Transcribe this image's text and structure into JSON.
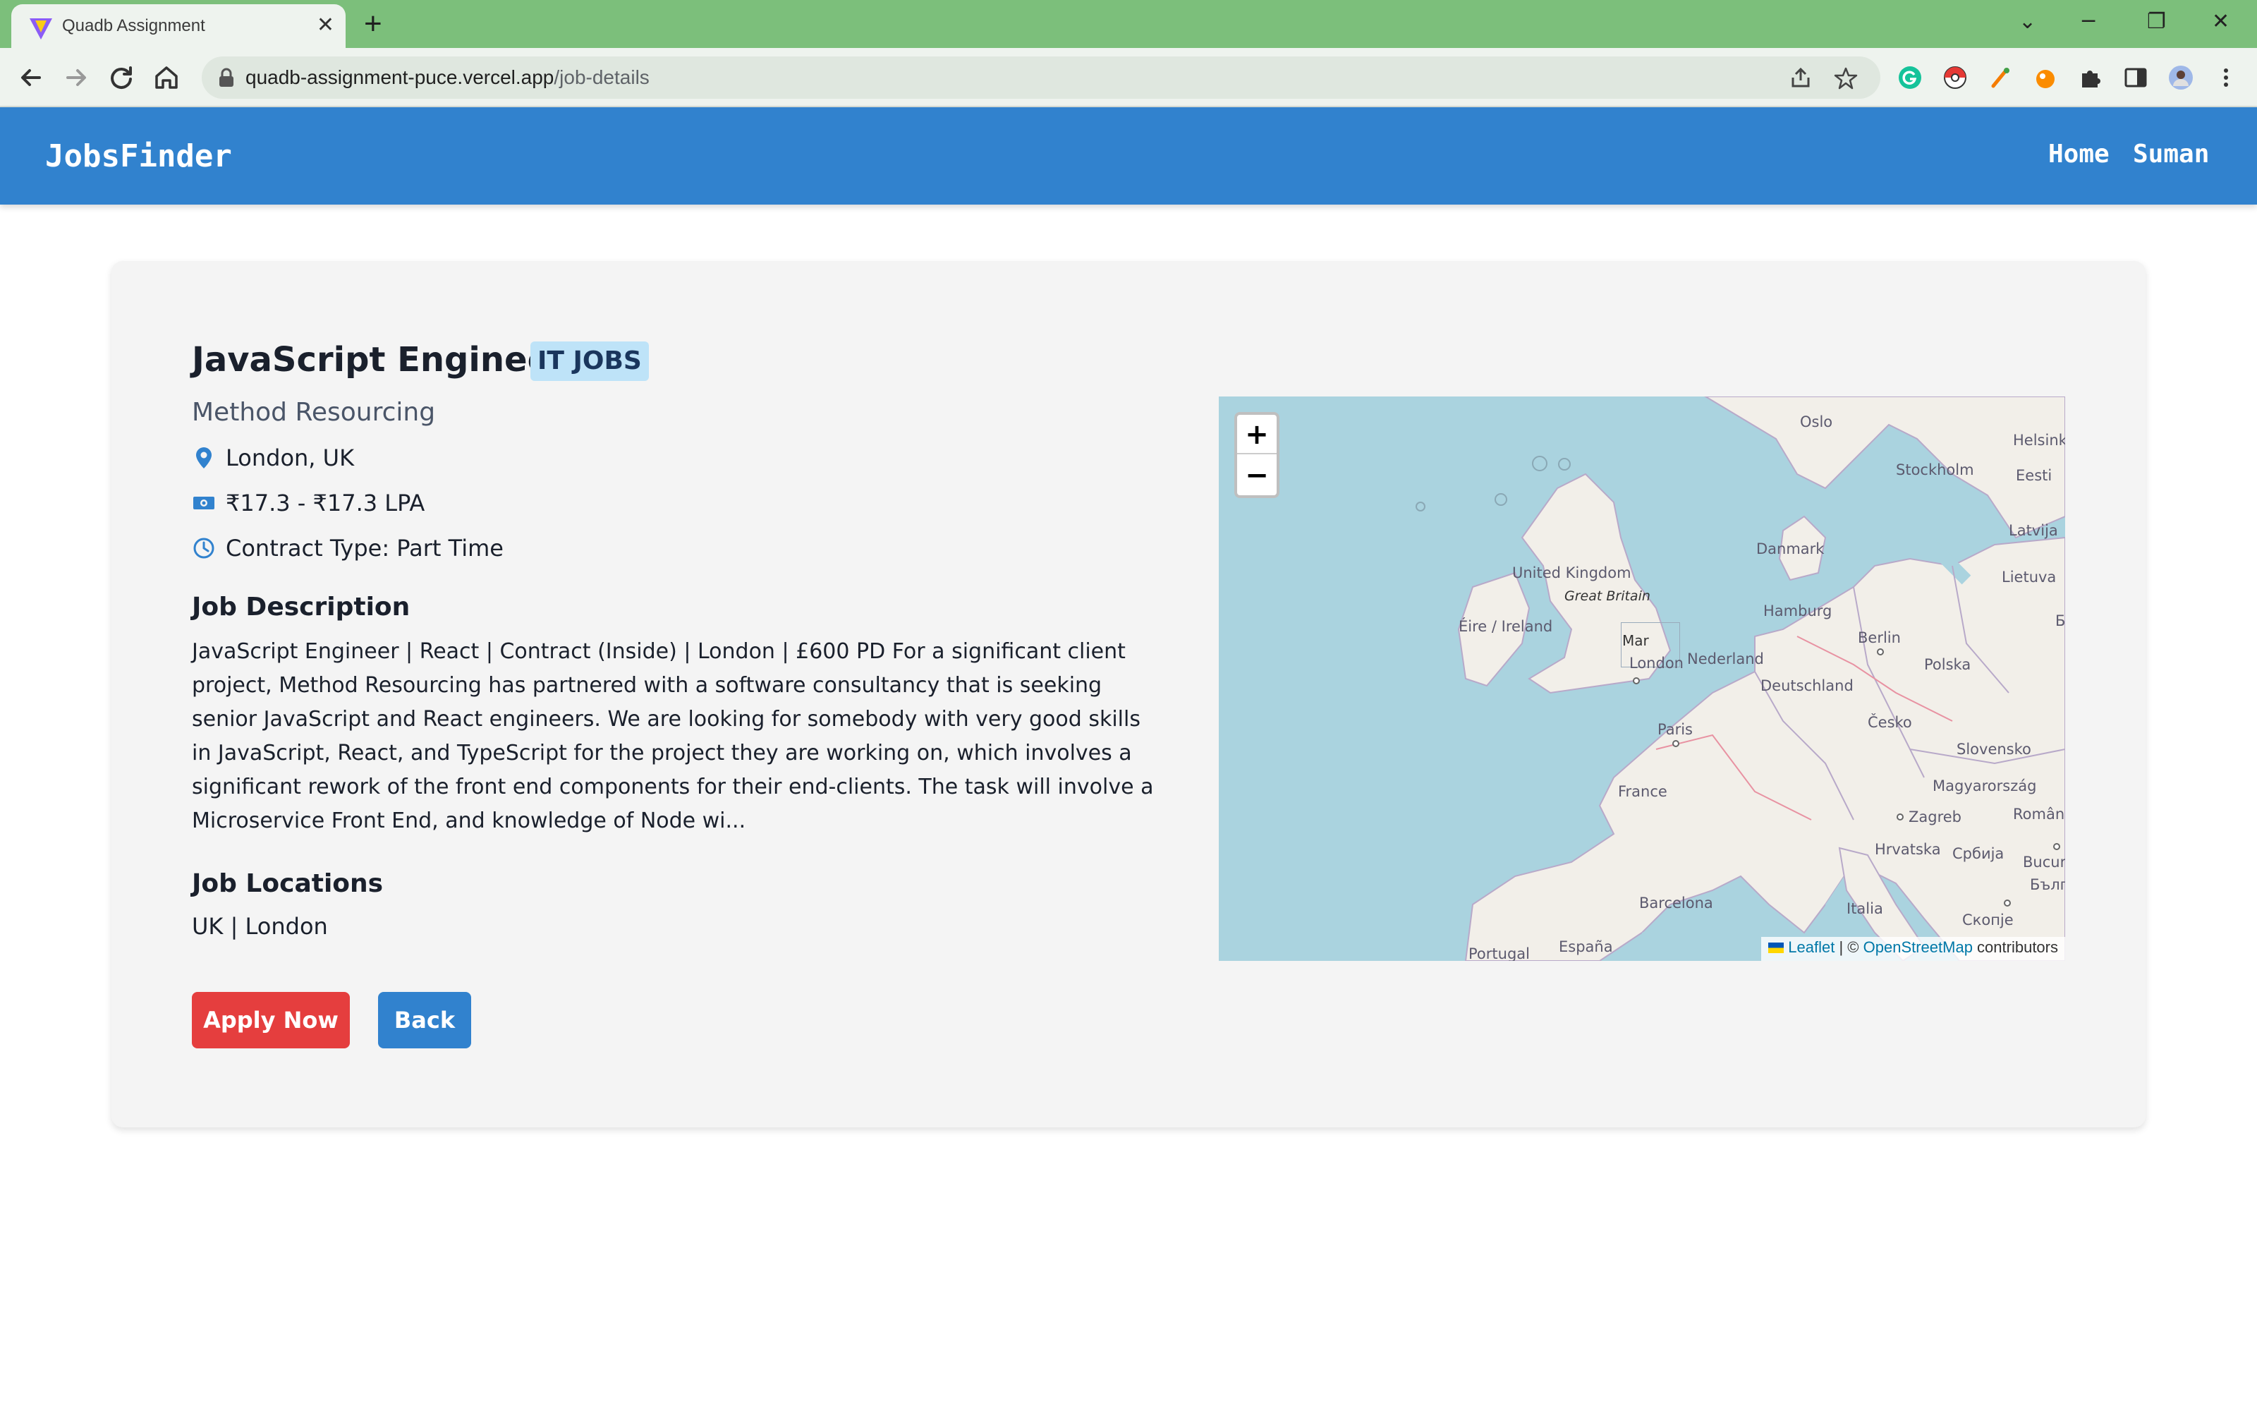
{
  "browser": {
    "tab_title": "Quadb Assignment",
    "tab_close": "✕",
    "new_tab": "+",
    "url_host": "quadb-assignment-puce.vercel.app",
    "url_path": "/job-details",
    "window_controls": {
      "tab_search": "⌄",
      "minimize": "─",
      "restore": "❐",
      "close": "✕"
    }
  },
  "header": {
    "brand": "JobsFinder",
    "nav": {
      "home": "Home",
      "user": "Suman"
    },
    "color": "#3182ce"
  },
  "job": {
    "title": "JavaScript Engineer",
    "category": "IT JOBS",
    "company": "Method Resourcing",
    "location": "London, UK",
    "salary": "₹17.3 - ₹17.3 LPA",
    "contract": "Contract Type: Part Time",
    "description_heading": "Job Description",
    "description": "JavaScript Engineer | React | Contract (Inside) | London | £600 PD For a significant client project, Method Resourcing has partnered with a software consultancy that is seeking senior JavaScript and React engineers. We are looking for somebody with very good skills in JavaScript, React, and TypeScript for the project they are working on, which involves a significant rework of the front end components for their end-clients. The task will involve a Microservice Front End, and knowledge of Node wi...",
    "locations_heading": "Job Locations",
    "locations": "UK | London"
  },
  "actions": {
    "apply": "Apply Now",
    "back": "Back",
    "apply_color": "#e53e3e",
    "back_color": "#3182ce"
  },
  "map": {
    "zoom_in": "+",
    "zoom_out": "−",
    "marker_label": "Mar",
    "attribution": {
      "leaflet": "Leaflet",
      "sep": " | © ",
      "osm": "OpenStreetMap",
      "suffix": " contributors"
    },
    "labels": {
      "oslo": "Oslo",
      "helsinki": "Helsink",
      "stockholm": "Stockholm",
      "eesti": "Eesti",
      "latvija": "Latvija",
      "danmark": "Danmark",
      "lietuva": "Lietuva",
      "uk": "United Kingdom",
      "gb": "Great Britain",
      "ireland": "Éire / Ireland",
      "hamburg": "Hamburg",
      "berlin": "Berlin",
      "london": "London",
      "nederland": "Nederland",
      "polska": "Polska",
      "deutschland": "Deutschland",
      "paris": "Paris",
      "cesko": "Česko",
      "slovensko": "Slovensko",
      "france": "France",
      "magyarorszag": "Magyarország",
      "zagreb": "Zagreb",
      "romania": "România",
      "hrvatska": "Hrvatska",
      "srbija": "Србија",
      "bucur": "Bucur",
      "barcelona": "Barcelona",
      "italia": "Italia",
      "bulgaria": "Българ",
      "skopje": "Скопје",
      "portugal": "Portugal",
      "espana": "España",
      "edge_b": "Б"
    }
  }
}
